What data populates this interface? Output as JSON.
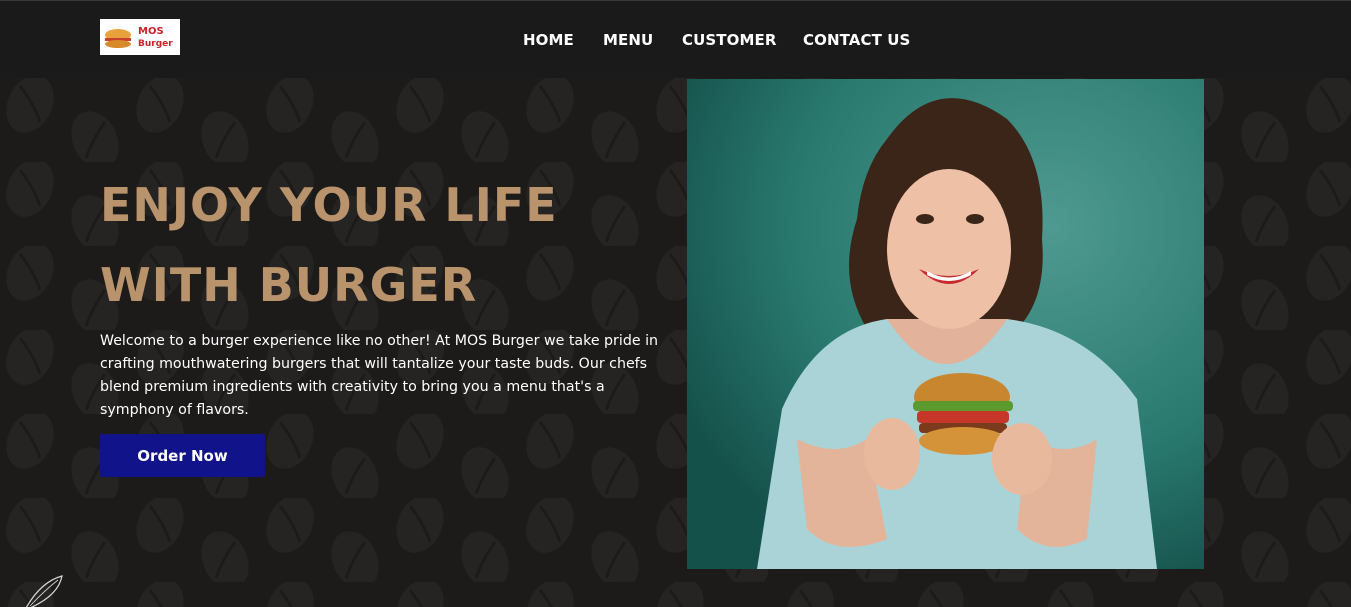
{
  "logo": {
    "line1": "MOS",
    "line2": "Burger",
    "alt": "MOS Burger logo"
  },
  "nav": {
    "items": [
      {
        "label": "HOME"
      },
      {
        "label": "MENU"
      },
      {
        "label": "CUSTOMER"
      },
      {
        "label": "CONTACT US"
      }
    ]
  },
  "hero": {
    "title": "ENJOY YOUR LIFE WITH BURGER",
    "description": "Welcome to a burger experience like no other! At MOS Burger we take pride in crafting mouthwatering burgers that will tantalize your taste buds. Our chefs blend premium ingredients with creativity to bring you a menu that's a symphony of flavors.",
    "button_label": "Order Now",
    "image_alt": "Smiling woman holding a burger"
  },
  "colors": {
    "background": "#1d1b1a",
    "navbar": "#1a1a1a",
    "title": "#b8936b",
    "button": "#10138a",
    "image_backdrop": "#1f6e66"
  }
}
